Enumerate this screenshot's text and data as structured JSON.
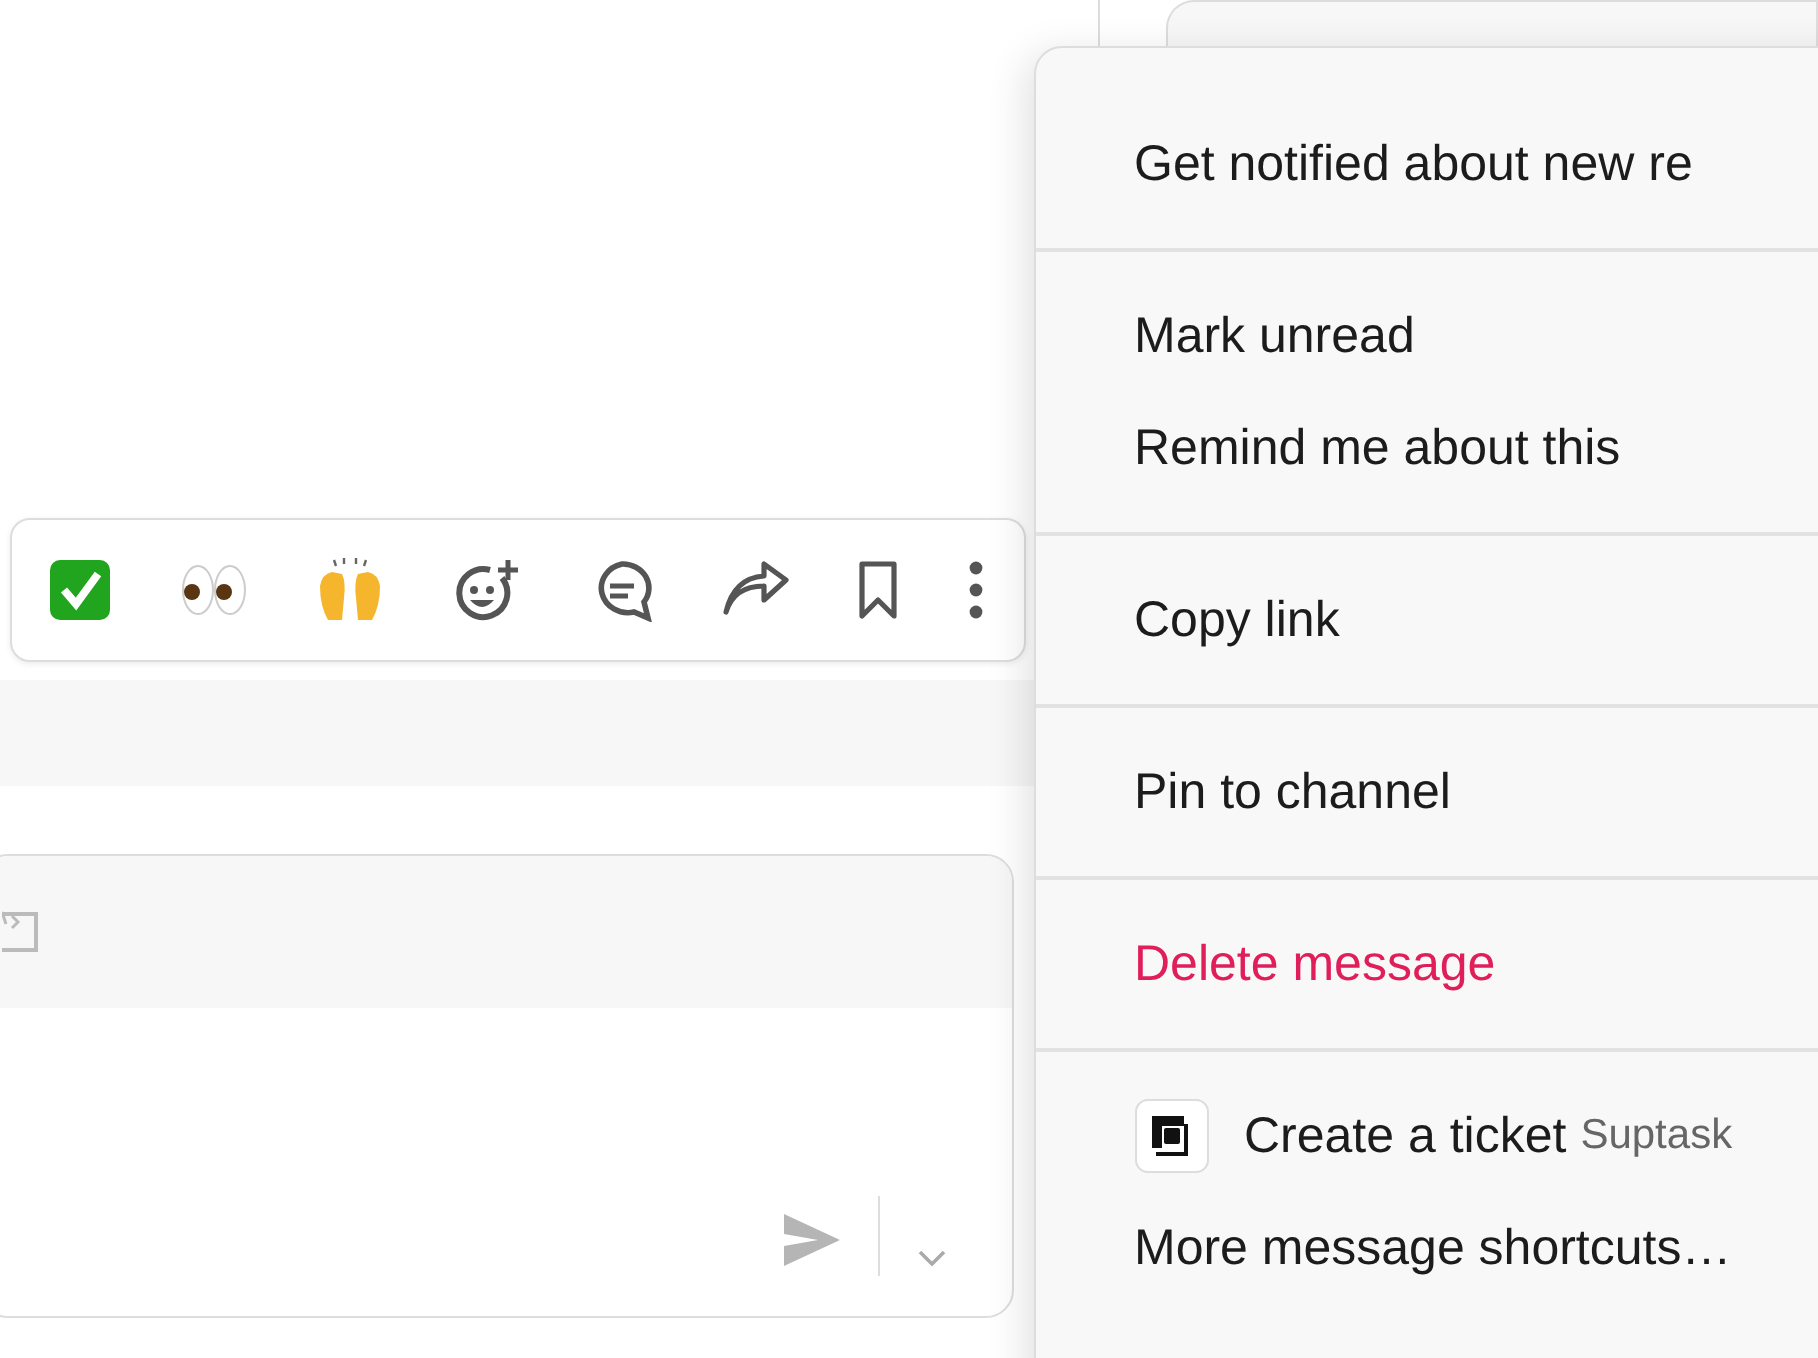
{
  "context_menu": {
    "sections": [
      [
        {
          "label": "Get notified about new re",
          "kind": "normal"
        }
      ],
      [
        {
          "label": "Mark unread",
          "kind": "normal"
        },
        {
          "label": "Remind me about this",
          "kind": "normal"
        }
      ],
      [
        {
          "label": "Copy link",
          "kind": "normal"
        }
      ],
      [
        {
          "label": "Pin to channel",
          "kind": "normal"
        }
      ],
      [
        {
          "label": "Delete message",
          "kind": "danger"
        }
      ],
      [
        {
          "label": "Create a ticket",
          "kind": "app",
          "app_name": "Suptask"
        },
        {
          "label": "More message shortcuts…",
          "kind": "normal"
        }
      ]
    ]
  }
}
